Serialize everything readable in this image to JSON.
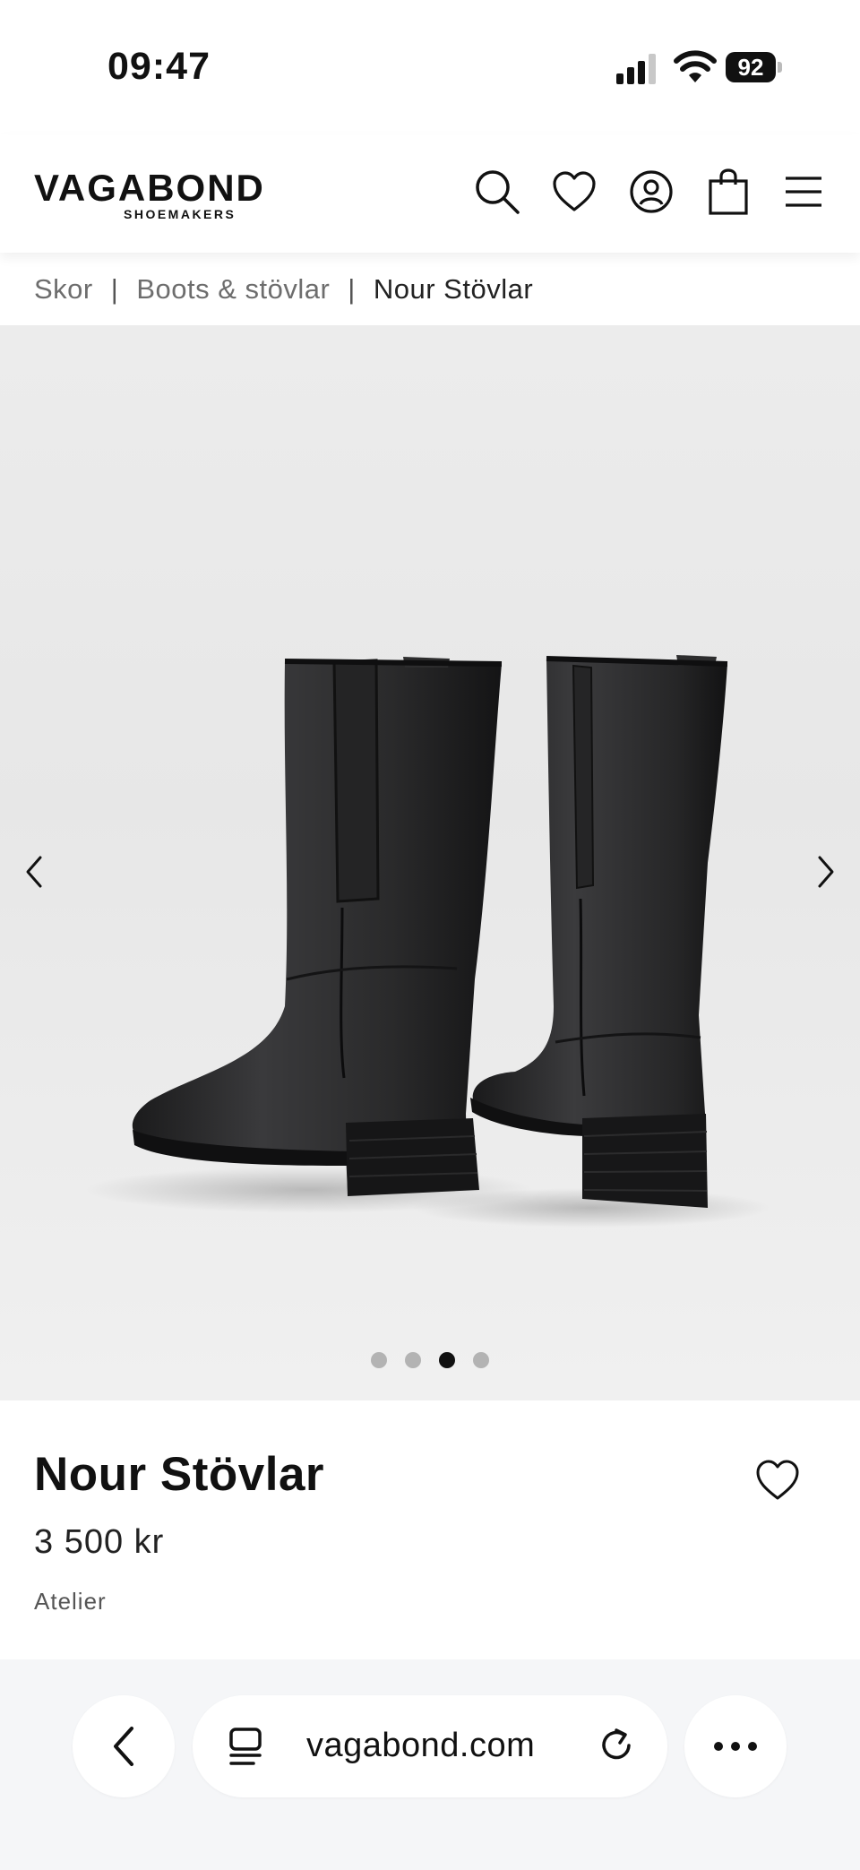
{
  "status_bar": {
    "time": "09:47",
    "battery": "92"
  },
  "header": {
    "logo": "VAGABOND",
    "logo_sub": "SHOEMAKERS",
    "icons": [
      "search-icon",
      "heart-icon",
      "account-icon",
      "bag-icon",
      "menu-icon"
    ]
  },
  "breadcrumb": {
    "items": [
      "Skor",
      "Boots & stövlar",
      "Nour Stövlar"
    ],
    "separator": "|"
  },
  "gallery": {
    "slide_count": 4,
    "active_slide": 3
  },
  "product": {
    "title": "Nour Stövlar",
    "price": "3 500 kr",
    "collection": "Atelier"
  },
  "browser": {
    "url": "vagabond.com"
  },
  "colors": {
    "accent": "#111111",
    "gallery_bg": "#e9e9e9",
    "browser_bg": "#f5f6f8"
  }
}
